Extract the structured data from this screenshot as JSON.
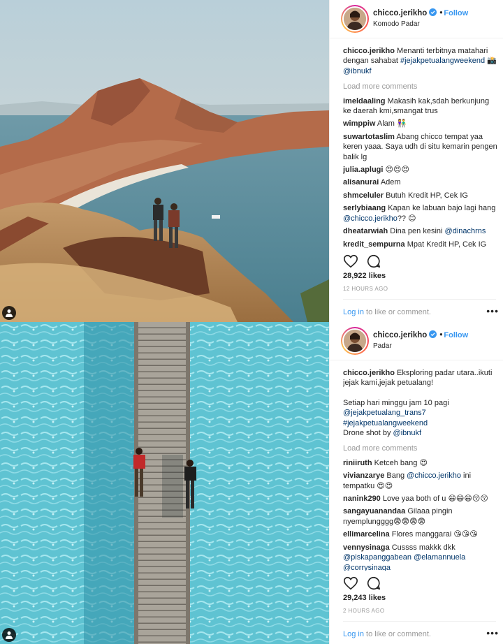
{
  "posts": [
    {
      "username": "chicco.jerikho",
      "follow_label": "Follow",
      "location": "Komodo Padar",
      "caption_user": "chicco.jerikho",
      "caption_text": "Menanti terbitnya matahari dengan sahabat",
      "caption_hashtag": "#jejakpetualangweekend",
      "caption_emoji": "📸",
      "caption_mention": "@ibnukf",
      "load_more": "Load more comments",
      "comments": [
        {
          "user": "imeldaaling",
          "text": "Makasih kak,sdah berkunjung ke daerah kmi,smangat trus"
        },
        {
          "user": "wimppiw",
          "text": "Alam 👫"
        },
        {
          "user": "suwartotaslim",
          "text": "Abang chicco tempat yaa keren yaaa. Saya udh di situ kemarin pengen balik lg"
        },
        {
          "user": "julia.aplugi",
          "text": "😍😍😍"
        },
        {
          "user": "alisanurai",
          "text": "Adem"
        },
        {
          "user": "shmceluler",
          "text": "Butuh Kredit HP, Cek IG"
        },
        {
          "user": "serlybiaang",
          "text": "Kapan ke labuan bajo lagi hang",
          "mention": "@chicco.jerikho",
          "tail": "?? 😊"
        },
        {
          "user": "dheatarwiah",
          "text": "Dina pen kesini",
          "mention": "@dinachrns"
        },
        {
          "user": "kredit_sempurna",
          "text": "Mpat Kredit HP, Cek IG"
        }
      ],
      "likes": "28,922 likes",
      "time_ago": "12 HOURS AGO",
      "login_link": "Log in",
      "login_suffix": " to like or comment.",
      "more_glyph": "•••",
      "icons": {
        "like": "heart-icon",
        "comment": "comment-icon",
        "options": "more-options-icon"
      }
    },
    {
      "username": "chicco.jerikho",
      "follow_label": "Follow",
      "location": "Padar",
      "caption_user": "chicco.jerikho",
      "caption_text": "Eksploring padar utara..ikuti jejak kami,jejak petualang!",
      "caption_line2": "Setiap hari minggu jam 10 pagi",
      "caption_mention1": "@jejakpetualang_trans7",
      "caption_hashtag": "#jejakpetualangweekend",
      "caption_drone": "Drone shot by",
      "caption_mention2": "@ibnukf",
      "load_more": "Load more comments",
      "comments": [
        {
          "user": "riniiruth",
          "text": "Ketceh bang 😍"
        },
        {
          "user": "vivianzarye",
          "text": "Bang",
          "mention": "@chicco.jerikho",
          "tail": "ini tempatku 😍😍"
        },
        {
          "user": "nanink290",
          "text": "Love yaa both of u 😄😄😄😚😚"
        },
        {
          "user": "sangayuanandaa",
          "text": "Gilaaa pingin nyemplungggg😨😨😨😨"
        },
        {
          "user": "ellimarcelina",
          "text": "Flores manggarai 😘😘😘"
        },
        {
          "user": "vennysinaga",
          "text": "Cussss makkk dkk",
          "mention": "@piskapanggabean",
          "mention2": "@elamannuela",
          "mention3": "@corrysinaga"
        }
      ],
      "likes": "29,243 likes",
      "time_ago": "2 HOURS AGO",
      "login_link": "Log in",
      "login_suffix": " to like or comment.",
      "more_glyph": "•••",
      "icons": {
        "like": "heart-icon",
        "comment": "comment-icon",
        "options": "more-options-icon"
      }
    }
  ],
  "colors": {
    "link": "#3897f0",
    "hashtag": "#003569",
    "muted": "#999999",
    "verified": "#3897f0"
  }
}
